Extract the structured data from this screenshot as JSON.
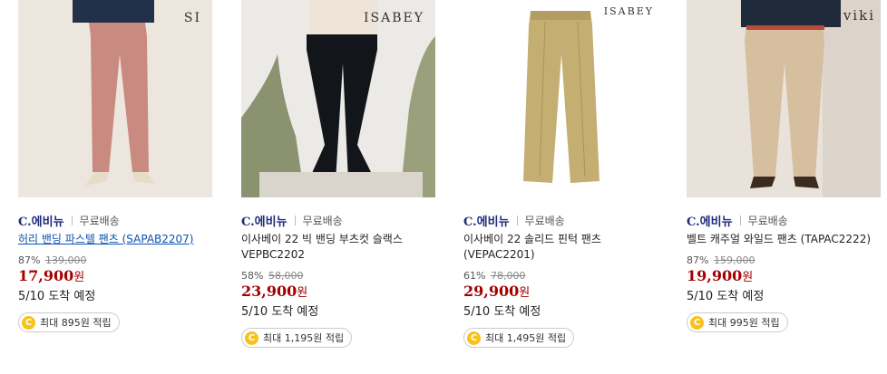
{
  "products": [
    {
      "brand_mark": "SI",
      "seller": "C.에비뉴",
      "shipping": "무료배송",
      "title": "허리 밴딩 파스텔 팬츠 (SAPAB2207)",
      "title_link": true,
      "discount": "87%",
      "original_price": "139,000",
      "price": "17,900",
      "won": "원",
      "arrival": "5/10 도착 예정",
      "points": "최대 895원 적립"
    },
    {
      "brand_mark": "ISABEY",
      "seller": "C.에비뉴",
      "shipping": "무료배송",
      "title": "이사베이 22 빅 밴딩 부츠컷 슬랙스 VEPBC2202",
      "title_link": false,
      "discount": "58%",
      "original_price": "58,000",
      "price": "23,900",
      "won": "원",
      "arrival": "5/10 도착 예정",
      "points": "최대 1,195원 적립"
    },
    {
      "brand_mark": "ISABEY",
      "seller": "C.에비뉴",
      "shipping": "무료배송",
      "title": "이사베이 22 솔리드 핀턱 팬츠 (VEPAC2201)",
      "title_link": false,
      "discount": "61%",
      "original_price": "78,000",
      "price": "29,900",
      "won": "원",
      "arrival": "5/10 도착 예정",
      "points": "최대 1,495원 적립"
    },
    {
      "brand_mark": "viki",
      "seller": "C.에비뉴",
      "shipping": "무료배송",
      "title": "벨트 캐주얼 와일드 팬츠 (TAPAC2222)",
      "title_link": false,
      "discount": "87%",
      "original_price": "159,000",
      "price": "19,900",
      "won": "원",
      "arrival": "5/10 도착 예정",
      "points": "최대 995원 적립"
    }
  ],
  "coin_symbol": "C",
  "colors": {
    "price": "#a50000",
    "seller_logo": "#1d2b7a",
    "link": "#0a53b0",
    "coin": "#f7c21a"
  }
}
